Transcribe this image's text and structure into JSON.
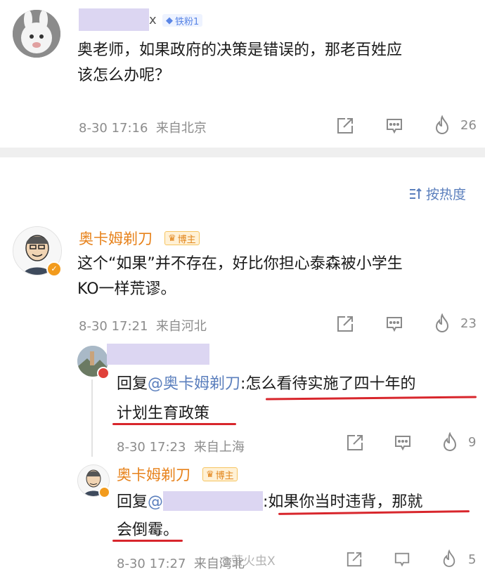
{
  "post": {
    "username_suffix": "x",
    "badge": "铁粉1",
    "text_line1": "奥老师，如果政府的决策是错误的，那老百姓应",
    "text_line2": "该怎么办呢？",
    "meta": "8-30 17:16  来自北京",
    "likes": "26"
  },
  "sort": {
    "label": "按热度"
  },
  "reply": {
    "author": "奥卡姆剃刀",
    "badge": "博主",
    "text_line1": "这个“如果”并不存在，好比你担心泰森被小学生",
    "text_line2": "KO一样荒谬。",
    "meta": "8-30 17:21  来自河北",
    "likes": "23"
  },
  "sub1": {
    "reply_prefix": "回复",
    "mention": "@奥卡姆剃刀",
    "text_after": ":怎么看待实施了四十年的",
    "text_line2": "计划生育政策",
    "meta": "8-30 17:23  来自上海",
    "likes": "9"
  },
  "sub2": {
    "author": "奥卡姆剃刀",
    "badge": "博主",
    "reply_prefix": "回复",
    "mention_at": "@",
    "text_after": ":如果你当时违背，那就",
    "text_line2": "会倒霉。",
    "meta": "8-30 17:27  来自湾北",
    "watermark": "@萤火虫X",
    "likes": "5"
  },
  "colors": {
    "accent_orange": "#e7821b",
    "mention_blue": "#5b7fbd",
    "redact_purple": "#dcd6f2",
    "underline_red": "#d8262c"
  }
}
